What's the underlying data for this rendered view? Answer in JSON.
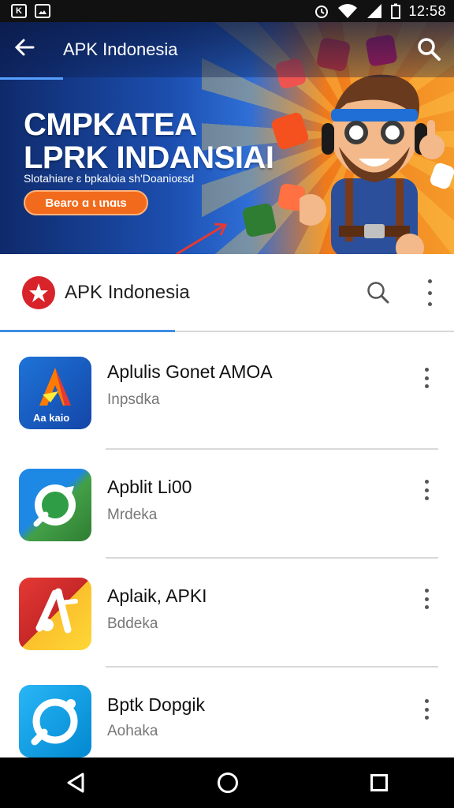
{
  "status_bar": {
    "time": "12:58",
    "left_icons": [
      "notification-icon",
      "photo-icon"
    ],
    "right_icons": [
      "alarm-icon",
      "wifi-icon",
      "signal-icon",
      "battery-icon"
    ]
  },
  "banner": {
    "app_title": "APK Indonesia",
    "headline_line1": "CMPKATEA",
    "headline_line2": "LPRK INDANSIAI",
    "subtext": "Slotahiare ɛ bpkaloia sh'Doanioɛsd",
    "cta_label": "Bearo ɑ ɩ ɩnɑɩs"
  },
  "appbar": {
    "title": "APK Indonesia"
  },
  "apps": [
    {
      "name": "Aplulis Gonet AMOA",
      "category": "Inpsdka",
      "icon_label": "Aa kaio",
      "colors": [
        "#1565c0",
        "#ff6f00"
      ]
    },
    {
      "name": "Apblit Li00",
      "category": "Mrdeka",
      "icon_label": "",
      "colors": [
        "#1e88e5",
        "#43a047"
      ]
    },
    {
      "name": "Aplaik, APKI",
      "category": "Bddeka",
      "icon_label": "",
      "colors": [
        "#d32f2f",
        "#fbc02d"
      ]
    },
    {
      "name": "Bptk Dopgik",
      "category": "Aohaka",
      "icon_label": "",
      "colors": [
        "#03a9f4",
        "#ffffff"
      ]
    }
  ],
  "nav": {
    "icons": [
      "back-icon",
      "home-icon",
      "recents-icon"
    ]
  }
}
